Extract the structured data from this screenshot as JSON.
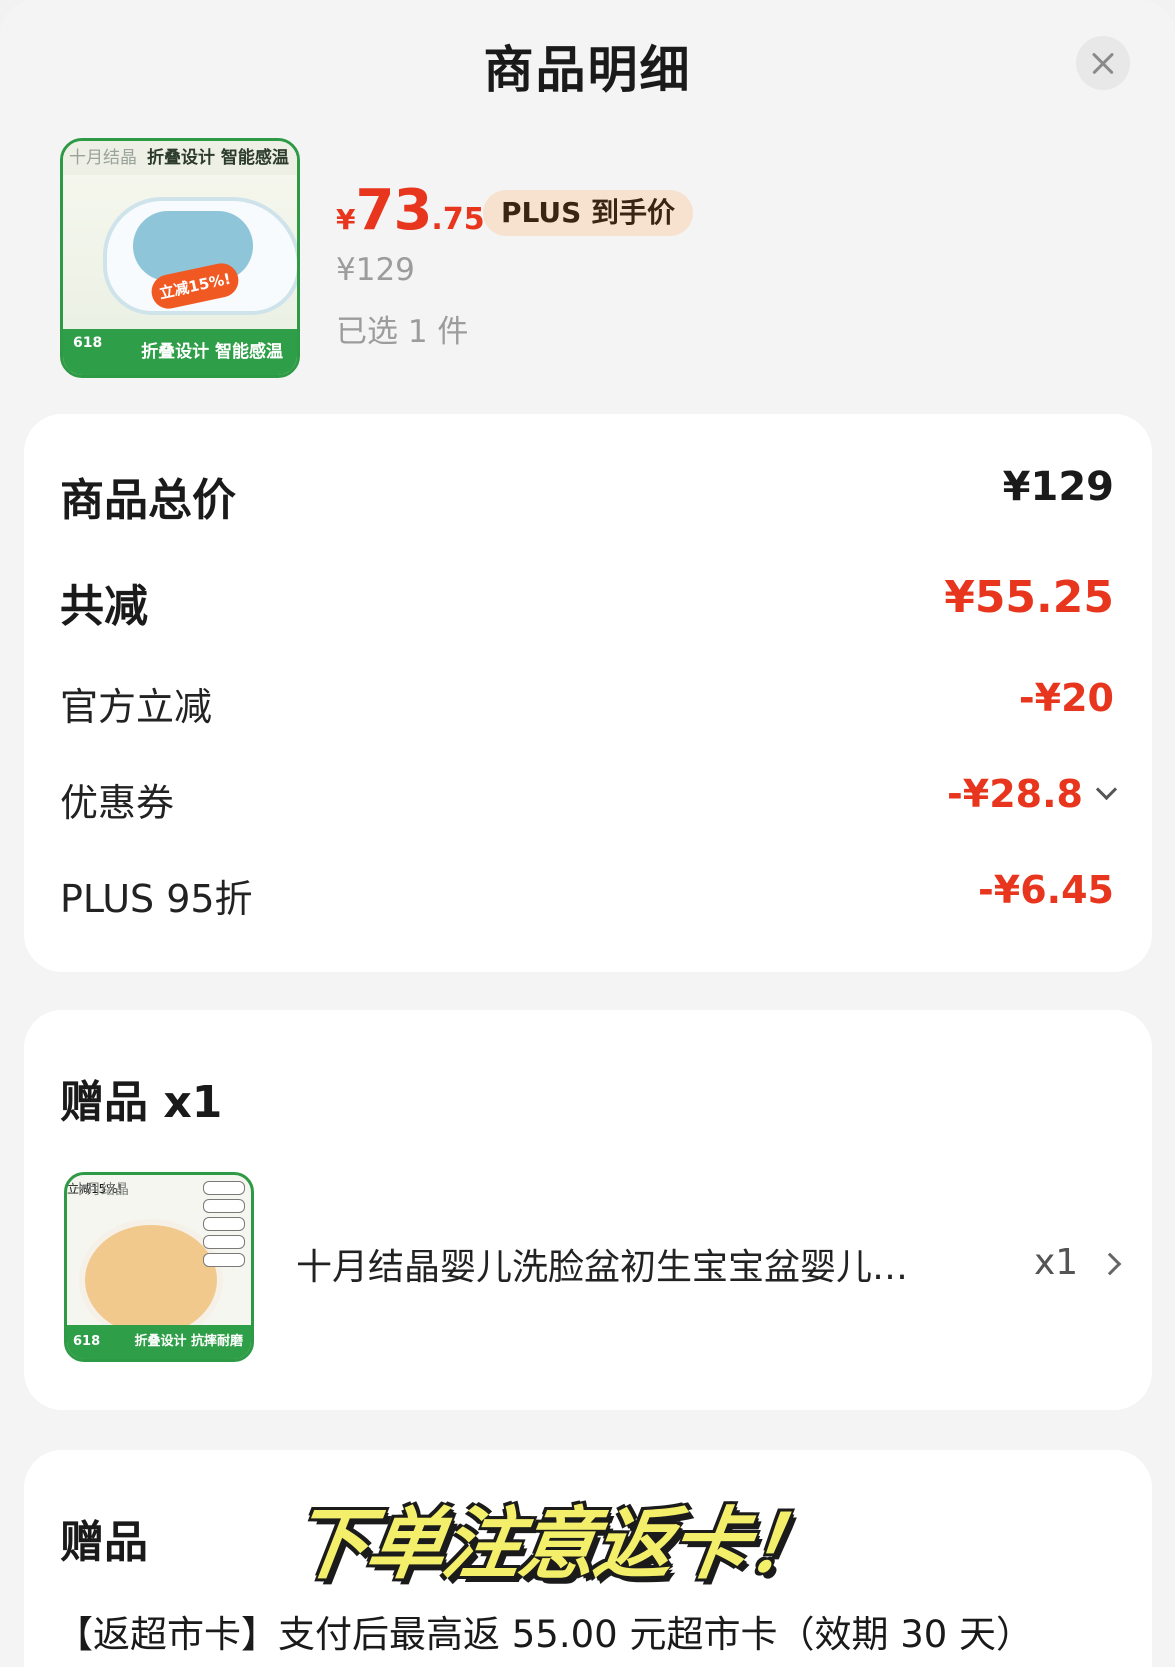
{
  "header": {
    "title": "商品明细"
  },
  "product": {
    "image_label": "product-thumbnail",
    "image_brand": "十月结晶",
    "image_headline": "折叠设计 智能感温",
    "image_seal": "立减15%!",
    "image_badge": "618",
    "image_footer": "折叠设计 智能感温",
    "price_currency": "¥",
    "price_integer": "73",
    "price_decimal": ".75",
    "plus_badge": "PLUS 到手价",
    "original_price": "¥129",
    "selected_count": "已选 1 件"
  },
  "summary": {
    "rows": [
      {
        "label": "商品总价",
        "value": "¥129"
      },
      {
        "label": "共减",
        "value": "¥55.25"
      },
      {
        "label": "官方立减",
        "value": "-¥20"
      },
      {
        "label": "优惠券",
        "value": "-¥28.8"
      },
      {
        "label": "PLUS 95折",
        "value": "-¥6.45"
      }
    ]
  },
  "gift": {
    "title": "赠品 x1",
    "item_name": "十月结晶婴儿洗脸盆初生宝宝盆婴儿洗脸盆",
    "item_quantity": "x1",
    "image_brand": "十月结晶",
    "image_seal": "立减15%!",
    "image_badge": "618",
    "image_footer": "折叠设计 抗摔耐磨"
  },
  "gift2": {
    "title": "赠品",
    "banner": "下单注意返卡！",
    "description": "【返超市卡】支付后最高返 55.00 元超市卡（效期 30 天）"
  },
  "colors": {
    "accent_red": "#e8351d",
    "plus_pill": "#f7e2cf",
    "banner_yellow": "#f4ef6a",
    "brand_green": "#2f9e48"
  }
}
